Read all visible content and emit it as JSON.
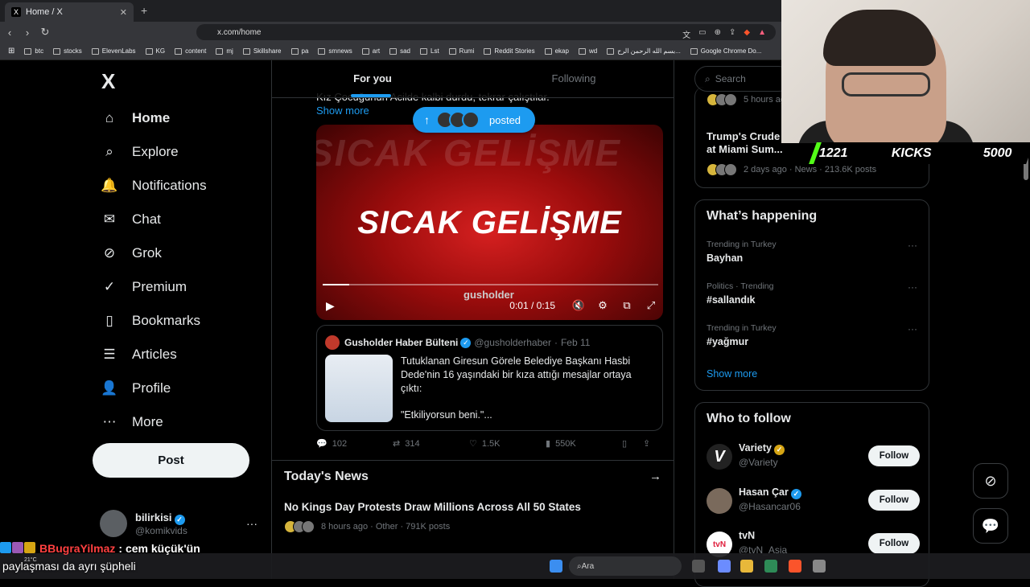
{
  "browser": {
    "tab_title": "Home / X",
    "tab_close": "✕",
    "new_tab": "+",
    "url": "x.com/home",
    "bookmarks": [
      "btc",
      "stocks",
      "ElevenLabs",
      "KG",
      "content",
      "mj",
      "Skillshare",
      "pa",
      "smnews",
      "art",
      "sad",
      "Lst",
      "Rumi",
      "Reddit Stories",
      "ekap",
      "wd",
      "بسم الله الرحمن الرح...",
      "Google Chrome Do..."
    ]
  },
  "nav": {
    "logo": "X",
    "items": [
      {
        "label": "Home",
        "icon": "⌂"
      },
      {
        "label": "Explore",
        "icon": "⌕"
      },
      {
        "label": "Notifications",
        "icon": "🔔"
      },
      {
        "label": "Chat",
        "icon": "✉"
      },
      {
        "label": "Grok",
        "icon": "⊘"
      },
      {
        "label": "Premium",
        "icon": "✓"
      },
      {
        "label": "Bookmarks",
        "icon": "▯"
      },
      {
        "label": "Articles",
        "icon": "☰"
      },
      {
        "label": "Profile",
        "icon": "👤"
      },
      {
        "label": "More",
        "icon": "⋯"
      }
    ],
    "post_label": "Post",
    "account_name": "bilirkisi",
    "account_handle": "@komikvids",
    "account_more": "···"
  },
  "feed": {
    "tabs": [
      "For you",
      "Following"
    ],
    "tweet_text": "Kız Çocuğunun Acilde kalbi durdu, tekrar çalıştılar.",
    "show_more": "Show more",
    "posted_pill": "posted",
    "video": {
      "bg_word": "SICAK GELİŞME",
      "headline": "SICAK GELİŞME",
      "brand": "gusholder",
      "time": "0:01 / 0:15",
      "progress": 0.08
    },
    "quote": {
      "name": "Gusholder Haber Bülteni",
      "handle": "@gusholderhaber",
      "date": "Feb 11",
      "text": "Tutuklanan Giresun Görele Belediye Başkanı Hasbi Dede'nin 16 yaşındaki bir kıza attığı mesajlar ortaya çıktı:",
      "text2": "\"Etkiliyorsun beni.\"..."
    },
    "actions": {
      "replies": "102",
      "reposts": "314",
      "likes": "1.5K",
      "views": "550K"
    },
    "news_title": "Today's News",
    "news_headline": "No Kings Day Protests Draw Millions Across All 50 States",
    "news_meta": "8 hours ago · Other · 791K posts"
  },
  "sidebar": {
    "search_placeholder": "Search",
    "top_meta": "5 hours ago",
    "trend2_title": "Trump's Crude Prince at Miami Sum...",
    "trend2_meta": "2 days ago · News · 213.6K posts",
    "whats_happening": "What’s happening",
    "trends": [
      {
        "context": "Trending in Turkey",
        "name": "Bayhan"
      },
      {
        "context": "Politics · Trending",
        "name": "#sallandık"
      },
      {
        "context": "Trending in Turkey",
        "name": "#yağmur"
      }
    ],
    "show_more": "Show more",
    "who_to_follow": "Who to follow",
    "follow": [
      {
        "name": "Variety",
        "handle": "@Variety",
        "badge": "gold",
        "avatar": "V"
      },
      {
        "name": "Hasan Çar",
        "handle": "@Hasancar06",
        "badge": "blue",
        "avatar": ""
      },
      {
        "name": "tvN",
        "handle": "@tvN_Asia",
        "badge": "none",
        "avatar": "tvN"
      }
    ],
    "follow_label": "Follow"
  },
  "overlay": {
    "kick_numbers": [
      "1221",
      "KICKS",
      "5000"
    ],
    "chat_user": "BBugraYilmaz",
    "chat_msg": ": cem küçük'ün",
    "chat_line2": "paylaşması da ayrı şüpheli",
    "temp": "21°C",
    "taskbar_search": "Ara"
  }
}
